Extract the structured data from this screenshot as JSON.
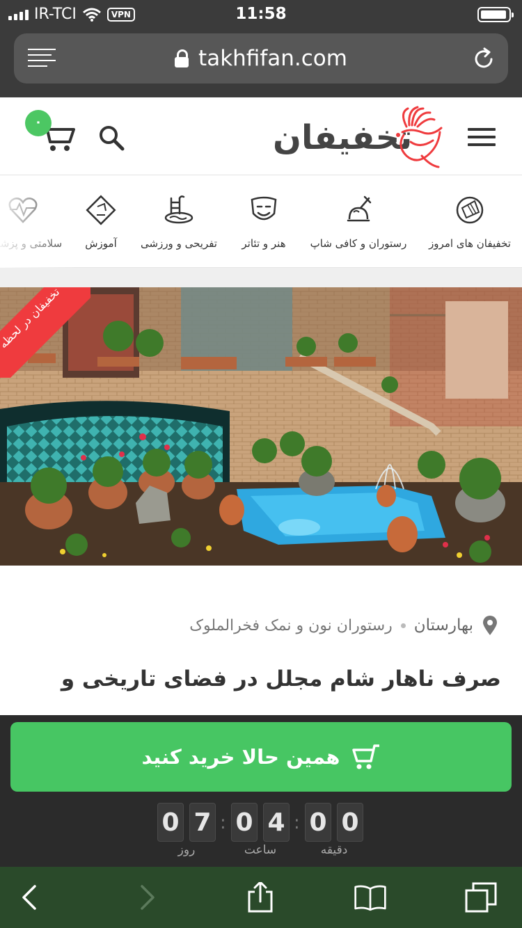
{
  "status_bar": {
    "carrier": "IR-TCI",
    "vpn_label": "VPN",
    "time": "11:58"
  },
  "browser": {
    "url": "takhfifan.com"
  },
  "header": {
    "logo_text": "تخفیفان",
    "cart_count": "۰",
    "brand_color": "#ef3b3e",
    "accent_color": "#47c663"
  },
  "categories": [
    {
      "label": "تخفیفان های امروز",
      "icon": "discount-tag-icon"
    },
    {
      "label": "رستوران و کافی شاپ",
      "icon": "food-plate-icon"
    },
    {
      "label": "هنر و تئاتر",
      "icon": "theater-mask-icon"
    },
    {
      "label": "تفریحی و ورزشی",
      "icon": "swimming-icon"
    },
    {
      "label": "آموزش",
      "icon": "education-icon"
    },
    {
      "label": "سلامتی و پزشکی",
      "icon": "heart-pulse-icon"
    }
  ],
  "hero": {
    "ribbon_text": "تخفیفان در لحظه"
  },
  "deal": {
    "city": "بهارستان",
    "venue": "رستوران نون و نمک فخرالملوک",
    "title": "صرف ناهار شام مجلل در فضای تاریخی و"
  },
  "purchase": {
    "button_label": "همین حالا خرید کنید",
    "countdown": {
      "days": [
        "0",
        "7"
      ],
      "hours": [
        "0",
        "4"
      ],
      "minutes": [
        "0",
        "0"
      ],
      "days_label": "روز",
      "hours_label": "ساعت",
      "minutes_label": "دقیقه"
    }
  }
}
